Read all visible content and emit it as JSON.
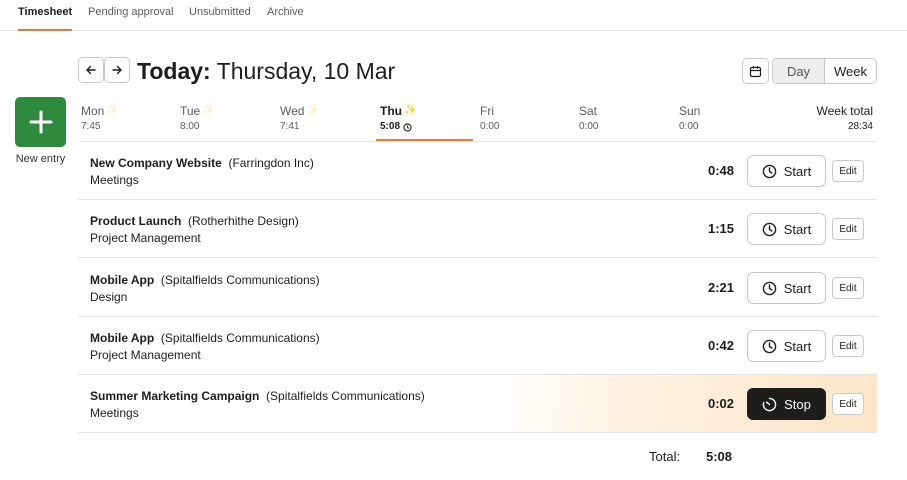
{
  "tabs": [
    {
      "label": "Timesheet"
    },
    {
      "label": "Pending approval"
    },
    {
      "label": "Unsubmitted"
    },
    {
      "label": "Archive"
    }
  ],
  "header": {
    "title_bold": "Today:",
    "title_rest": " Thursday, 10 Mar",
    "view_options": {
      "day": "Day",
      "week": "Week"
    }
  },
  "new_entry": {
    "label": "New entry"
  },
  "days": [
    {
      "name": "Mon",
      "time": "7:45"
    },
    {
      "name": "Tue",
      "time": "8:00"
    },
    {
      "name": "Wed",
      "time": "7:41"
    },
    {
      "name": "Thu",
      "time": "5:08"
    },
    {
      "name": "Fri",
      "time": "0:00"
    },
    {
      "name": "Sat",
      "time": "0:00"
    },
    {
      "name": "Sun",
      "time": "0:00"
    }
  ],
  "week_total": {
    "label": "Week total",
    "value": "28:34"
  },
  "entries": [
    {
      "project": "New Company Website",
      "client": "(Farringdon Inc)",
      "task": "Meetings",
      "duration": "0:48",
      "action": "Start",
      "edit": "Edit"
    },
    {
      "project": "Product Launch",
      "client": "(Rotherhithe Design)",
      "task": "Project Management",
      "duration": "1:15",
      "action": "Start",
      "edit": "Edit"
    },
    {
      "project": "Mobile App",
      "client": "(Spitalfields Communications)",
      "task": "Design",
      "duration": "2:21",
      "action": "Start",
      "edit": "Edit"
    },
    {
      "project": "Mobile App",
      "client": "(Spitalfields Communications)",
      "task": "Project Management",
      "duration": "0:42",
      "action": "Start",
      "edit": "Edit"
    },
    {
      "project": "Summer Marketing Campaign",
      "client": "(Spitalfields Communications)",
      "task": "Meetings",
      "duration": "0:02",
      "action": "Stop",
      "edit": "Edit"
    }
  ],
  "total": {
    "label": "Total:",
    "value": "5:08"
  },
  "colors": {
    "accent": "#e57c3d",
    "new_entry": "#2e8b3e",
    "stop_button": "#1d1e1c",
    "running_highlight": "#fde5c7"
  }
}
